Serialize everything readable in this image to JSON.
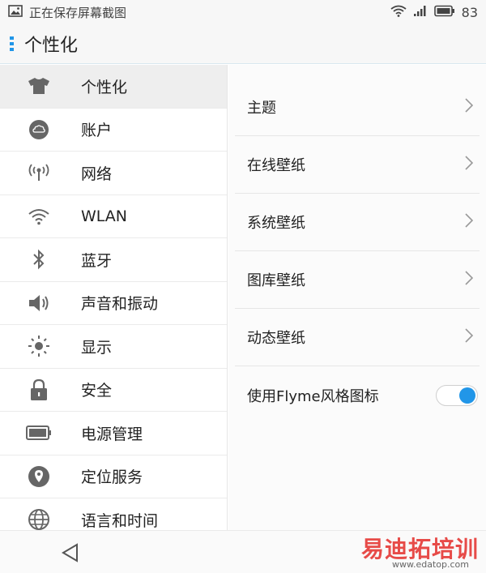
{
  "status_bar": {
    "message": "正在保存屏幕截图",
    "battery_percent": "83",
    "icons": [
      "image-icon",
      "wifi-icon",
      "signal-icon",
      "battery-icon"
    ]
  },
  "app_bar": {
    "title": "个性化"
  },
  "sidebar": {
    "items": [
      {
        "label": "个性化",
        "icon": "tshirt-icon",
        "active": true
      },
      {
        "label": "账户",
        "icon": "cloud-account-icon"
      },
      {
        "label": "网络",
        "icon": "antenna-icon"
      },
      {
        "label": "WLAN",
        "icon": "wifi-icon"
      },
      {
        "label": "蓝牙",
        "icon": "bluetooth-icon"
      },
      {
        "label": "声音和振动",
        "icon": "speaker-icon"
      },
      {
        "label": "显示",
        "icon": "sun-icon"
      },
      {
        "label": "安全",
        "icon": "lock-icon"
      },
      {
        "label": "电源管理",
        "icon": "battery-icon"
      },
      {
        "label": "定位服务",
        "icon": "location-pin-icon"
      },
      {
        "label": "语言和时间",
        "icon": "globe-icon"
      }
    ]
  },
  "panel": {
    "rows": [
      {
        "label": "主题"
      },
      {
        "label": "在线壁纸"
      },
      {
        "label": "系统壁纸"
      },
      {
        "label": "图库壁纸"
      },
      {
        "label": "动态壁纸"
      }
    ],
    "toggle_row": {
      "label": "使用Flyme风格图标",
      "checked": true
    }
  },
  "nav_bar": {
    "icons": [
      "back-triangle-icon"
    ]
  },
  "watermark": {
    "text": "易迪拓培训",
    "url": "www.edatop.com"
  },
  "colors": {
    "accent": "#2196e8",
    "watermark": "#e53935"
  }
}
